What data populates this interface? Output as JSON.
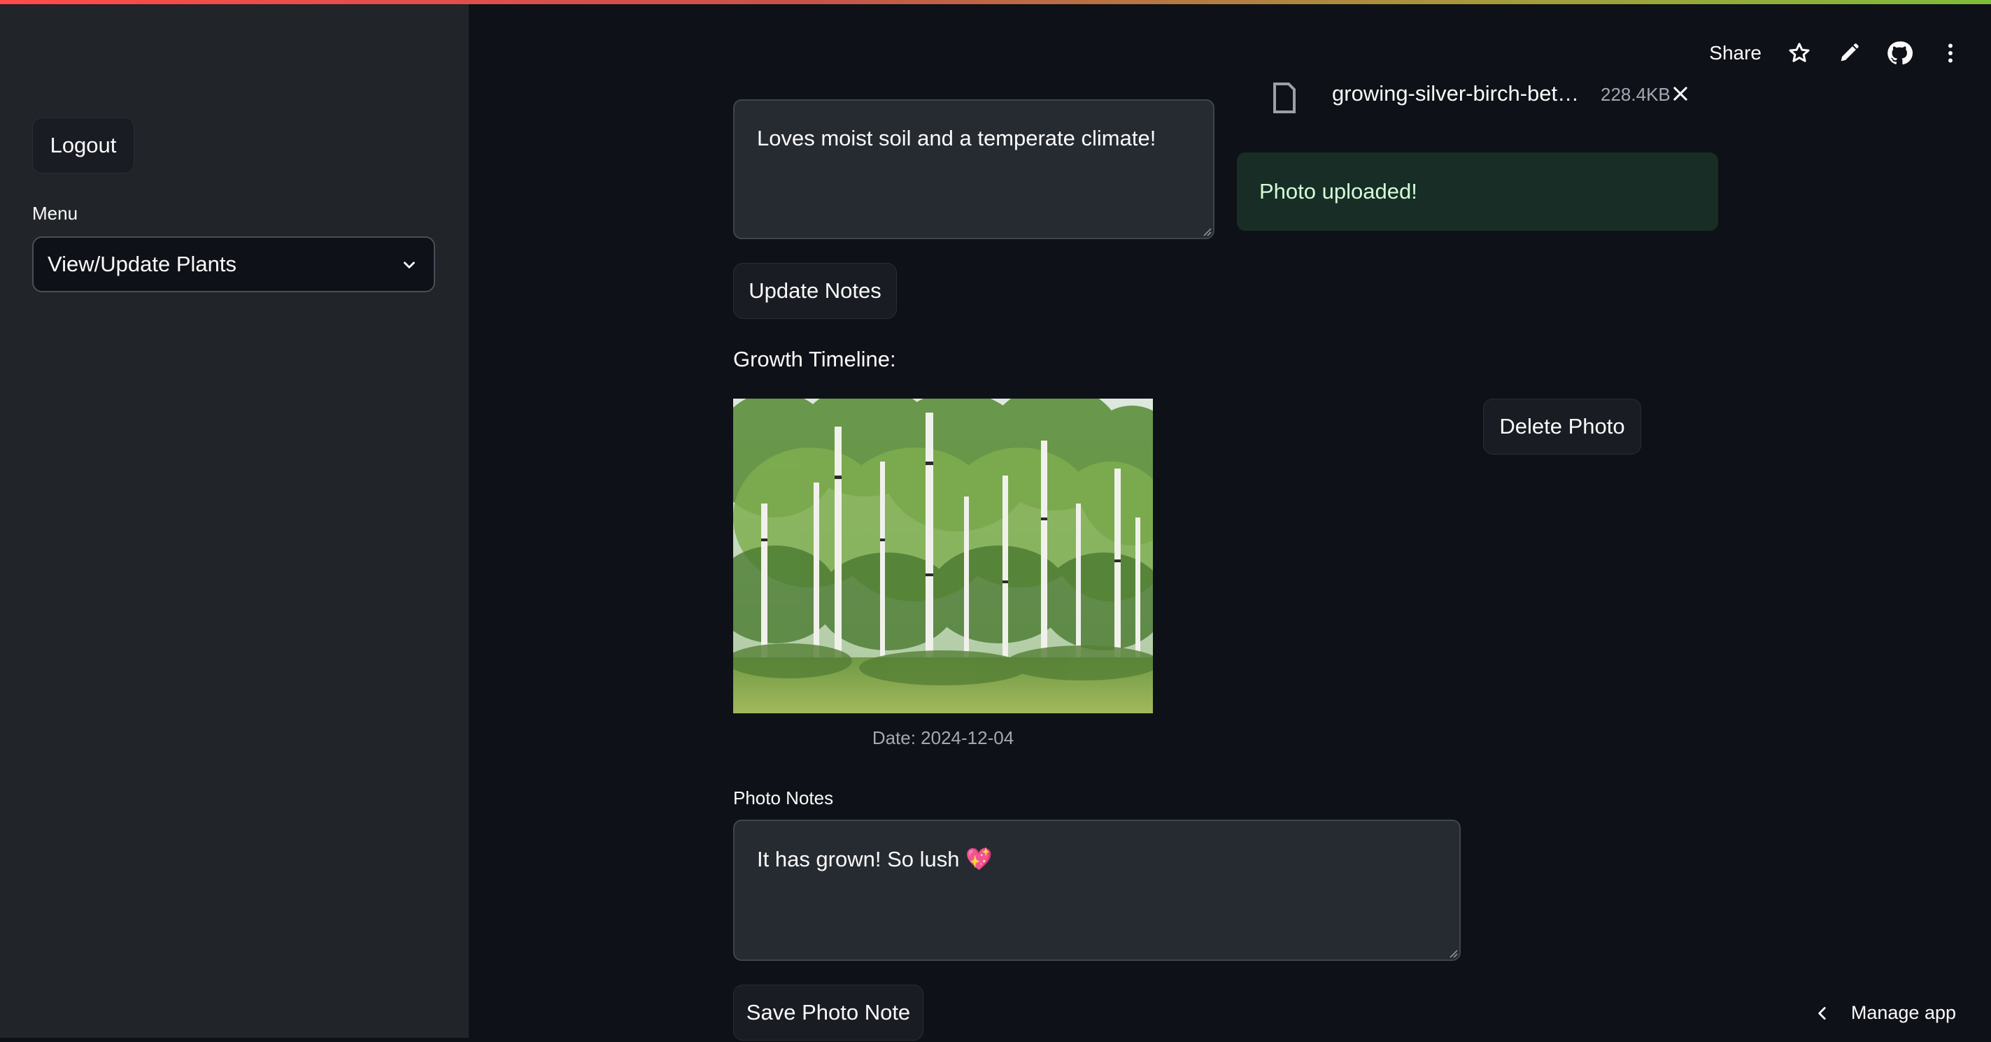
{
  "sidebar": {
    "logout_label": "Logout",
    "menu_label": "Menu",
    "menu_selected": "View/Update Plants"
  },
  "toolbar": {
    "share_label": "Share",
    "icons": [
      "star-icon",
      "pencil-icon",
      "github-icon",
      "more-vert-icon"
    ]
  },
  "notes": {
    "value": "Loves moist soil and a temperate climate!",
    "update_label": "Update Notes"
  },
  "uploader": {
    "file_name": "growing-silver-birch-bet…",
    "file_size": "228.4KB",
    "success_message": "Photo uploaded!"
  },
  "timeline": {
    "heading": "Growth Timeline:",
    "photo_caption": "Date: 2024-12-04",
    "delete_label": "Delete Photo",
    "photo_notes_label": "Photo Notes",
    "photo_notes_value": "It has grown! So lush 💖",
    "save_label": "Save Photo Note"
  },
  "footer": {
    "manage_label": "Manage app"
  },
  "colors": {
    "background": "#0e1117",
    "sidebar": "#212429",
    "success_bg": "#172d25",
    "success_text": "#d6fcd9"
  }
}
